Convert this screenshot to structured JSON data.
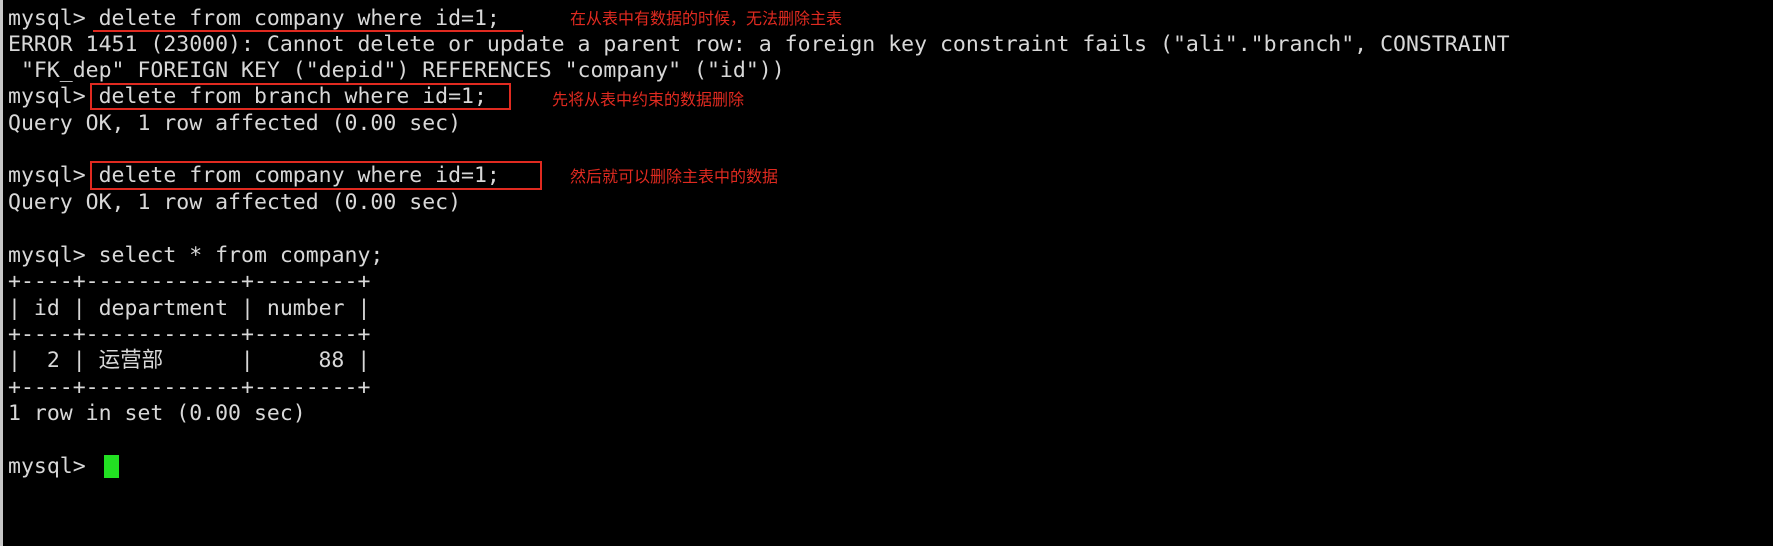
{
  "terminal": {
    "title": "mysql-terminal",
    "background_color": "#000000",
    "text_color": "#d8d8d8",
    "annotation_color": "#e02a20",
    "cursor_color": "#22e022",
    "prompt": "mysql>",
    "lines": [
      {
        "id": "l0",
        "text": "mysql> delete from company where id=1;"
      },
      {
        "id": "l1",
        "text": "ERROR 1451 (23000): Cannot delete or update a parent row: a foreign key constraint fails (\"ali\".\"branch\", CONSTRAINT"
      },
      {
        "id": "l2",
        "text": " \"FK_dep\" FOREIGN KEY (\"depid\") REFERENCES \"company\" (\"id\"))"
      },
      {
        "id": "l3",
        "text": "mysql> delete from branch where id=1;"
      },
      {
        "id": "l4",
        "text": "Query OK, 1 row affected (0.00 sec)"
      },
      {
        "id": "l5",
        "text": ""
      },
      {
        "id": "l6",
        "text": "mysql> delete from company where id=1;"
      },
      {
        "id": "l7",
        "text": "Query OK, 1 row affected (0.00 sec)"
      },
      {
        "id": "l8",
        "text": ""
      },
      {
        "id": "l9",
        "text": "mysql> select * from company;"
      },
      {
        "id": "l10",
        "text": "+----+------------+--------+"
      },
      {
        "id": "l11",
        "text": "| id | department | number |"
      },
      {
        "id": "l12",
        "text": "+----+------------+--------+"
      },
      {
        "id": "l13",
        "text": "|  2 | 运营部      |     88 |"
      },
      {
        "id": "l14",
        "text": "+----+------------+--------+"
      },
      {
        "id": "l15",
        "text": "1 row in set (0.00 sec)"
      },
      {
        "id": "l16",
        "text": ""
      },
      {
        "id": "l17",
        "text": "mysql> "
      }
    ]
  },
  "annotations": [
    {
      "id": "a1",
      "text": "在从表中有数据的时候，无法删除主表"
    },
    {
      "id": "a2",
      "text": "先将从表中约束的数据删除"
    },
    {
      "id": "a3",
      "text": "然后就可以删除主表中的数据"
    }
  ],
  "query_result": {
    "type": "table",
    "columns": [
      "id",
      "department",
      "number"
    ],
    "rows": [
      [
        "2",
        "运营部",
        "88"
      ]
    ],
    "row_count_text": "1 row in set (0.00 sec)"
  },
  "error": {
    "code": "1451",
    "sqlstate": "23000",
    "message": "Cannot delete or update a parent row: a foreign key constraint fails",
    "table": "\"ali\".\"branch\"",
    "constraint_name": "\"FK_dep\"",
    "foreign_key_column": "\"depid\"",
    "references_table": "\"company\"",
    "references_column": "\"id\""
  }
}
